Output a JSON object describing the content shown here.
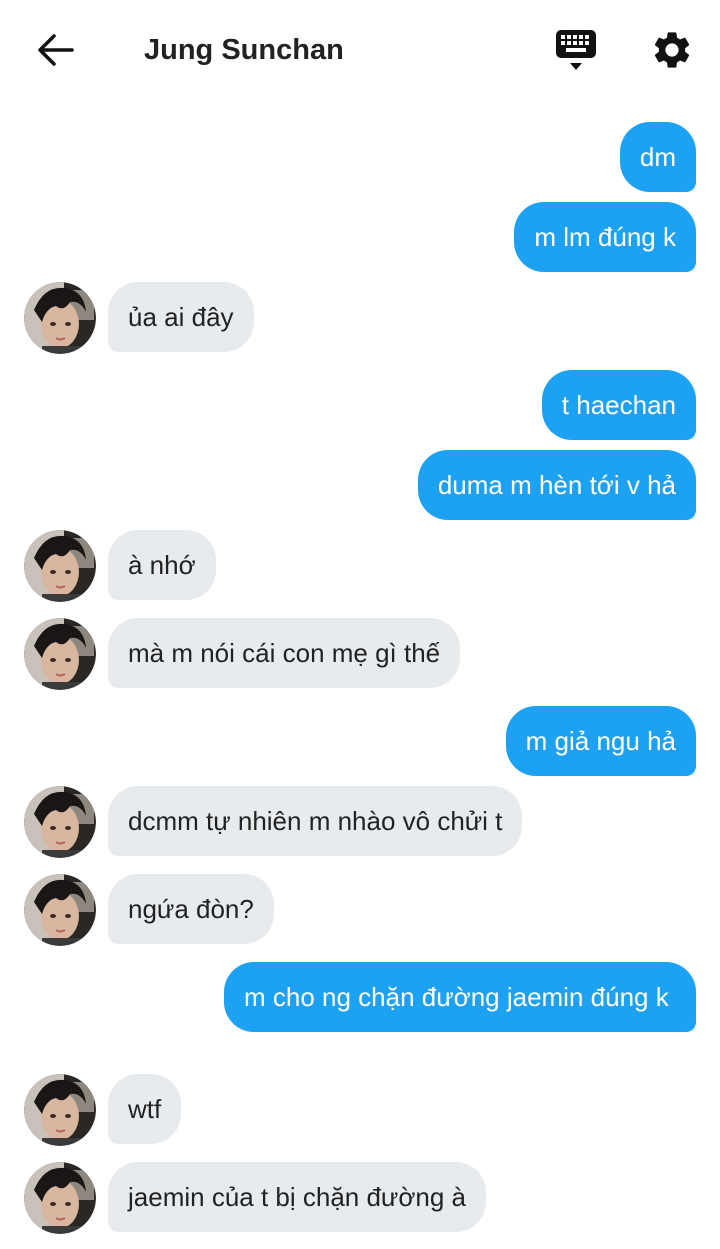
{
  "header": {
    "title": "Jung Sunchan",
    "icons": [
      "arrow-left-icon",
      "keyboard-icon",
      "gear-icon"
    ]
  },
  "colors": {
    "sent_bubble": "#1da1f2",
    "received_bubble": "#e8ebee",
    "sent_text": "#ffffff",
    "received_text": "#222222"
  },
  "messages": [
    {
      "from": "me",
      "text": "dm"
    },
    {
      "from": "me",
      "text": "m lm đúng k"
    },
    {
      "from": "them",
      "text": "ủa ai đây"
    },
    {
      "from": "me",
      "text": "t haechan"
    },
    {
      "from": "me",
      "text": "duma m hèn tới v hả"
    },
    {
      "from": "them",
      "text": "à nhớ"
    },
    {
      "from": "them",
      "text": "mà m nói cái con mẹ gì thế"
    },
    {
      "from": "me",
      "text": "m giả ngu hả"
    },
    {
      "from": "them",
      "text": "dcmm tự nhiên m nhào vô chửi t"
    },
    {
      "from": "them",
      "text": "ngứa đòn?"
    },
    {
      "from": "me",
      "text": "m cho ng chặn đường jaemin đúng k"
    },
    {
      "from": "them",
      "text": "wtf"
    },
    {
      "from": "them",
      "text": "jaemin của t bị chặn đường à"
    }
  ]
}
